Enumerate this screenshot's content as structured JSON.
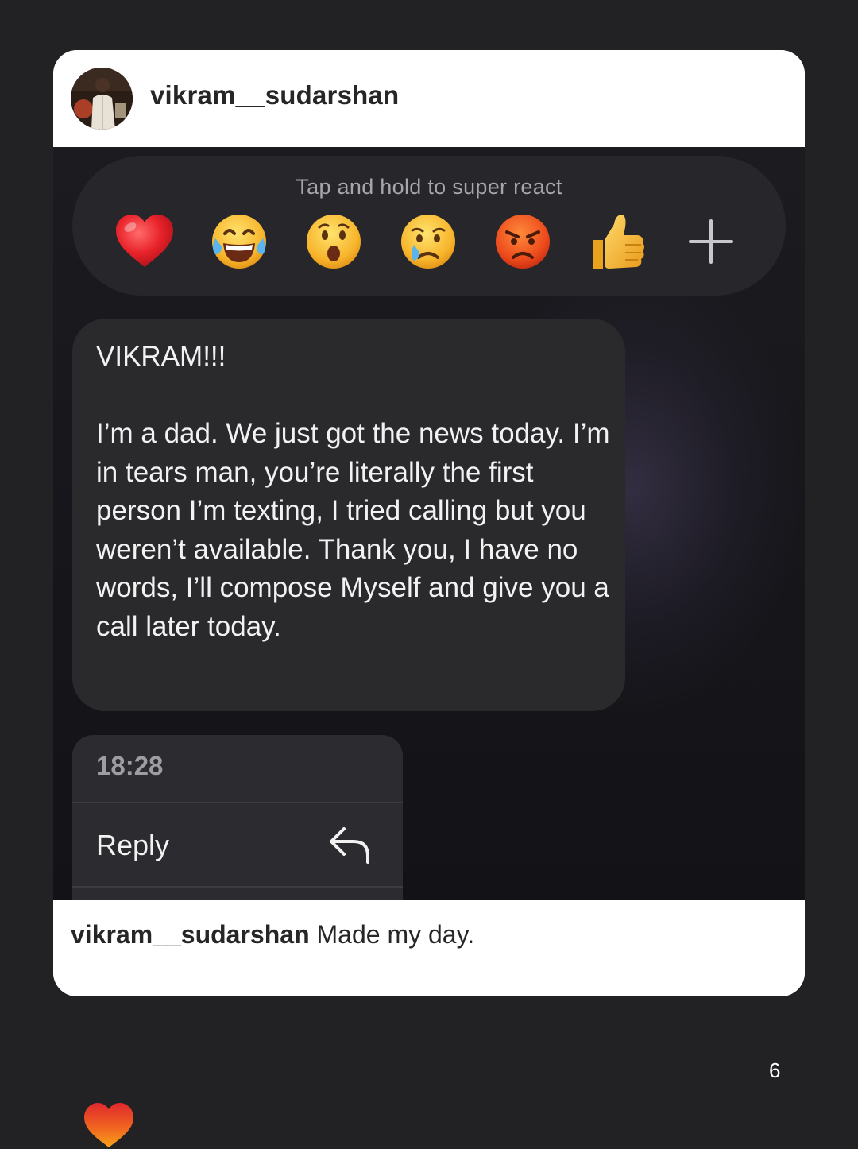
{
  "post": {
    "username": "vikram__sudarshan",
    "avatar_icon": "profile-photo",
    "caption_user": "vikram__sudarshan",
    "caption_text": " Made my day."
  },
  "dm": {
    "react_hint": "Tap and hold to super react",
    "reactions": [
      {
        "name": "red-heart-emoji"
      },
      {
        "name": "tears-of-joy-emoji"
      },
      {
        "name": "surprised-face-emoji"
      },
      {
        "name": "crying-face-emoji"
      },
      {
        "name": "angry-face-emoji"
      },
      {
        "name": "thumbs-up-emoji"
      },
      {
        "name": "add-reaction-plus-icon"
      }
    ],
    "message": "VIKRAM!!!\n\nI’m a dad. We just got the news today. I’m in tears man, you’re literally the first person I’m texting, I tried calling but you weren’t available. Thank you, I have no words, I’ll compose Myself and give you a call later today.",
    "time": "18:28",
    "reply_label": "Reply"
  },
  "footer": {
    "page_number": "6"
  },
  "colors": {
    "page_background": "#222224",
    "card_background": "#ffffff",
    "dm_background": "#18171c",
    "bubble_background": "#2a2a2d",
    "heart_red": "#e0282e"
  }
}
